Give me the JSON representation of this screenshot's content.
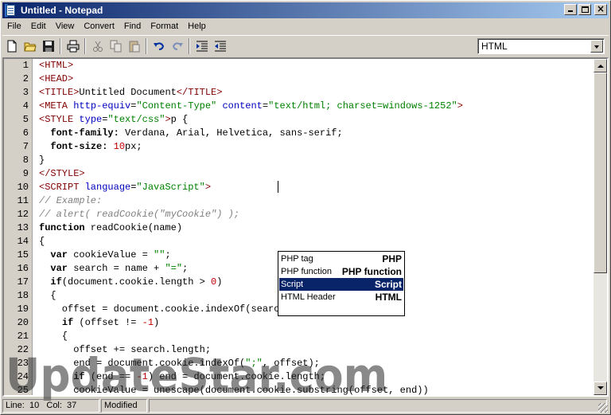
{
  "window": {
    "title": "Untitled - Notepad"
  },
  "menu": [
    "File",
    "Edit",
    "View",
    "Convert",
    "Find",
    "Format",
    "Help"
  ],
  "toolbar": {
    "buttons": [
      "new-file",
      "open-folder",
      "save",
      "print",
      "cut",
      "copy",
      "paste",
      "undo",
      "redo",
      "indent",
      "outdent"
    ],
    "language_selected": "HTML"
  },
  "gutter": {
    "line_numbers": [
      "1",
      "2",
      "3",
      "4",
      "5",
      "6",
      "7",
      "8",
      "9",
      "10",
      "11",
      "12",
      "13",
      "14",
      "15",
      "16",
      "17",
      "18",
      "19",
      "20",
      "21",
      "22",
      "23",
      "24",
      "25"
    ]
  },
  "code_lines": [
    [
      [
        "t-tag",
        "<HTML>"
      ]
    ],
    [
      [
        "t-tag",
        "<HEAD>"
      ]
    ],
    [
      [
        "t-tag",
        "<TITLE>"
      ],
      [
        "t-txt",
        "Untitled Document"
      ],
      [
        "t-tag",
        "</TITLE>"
      ]
    ],
    [
      [
        "t-tag",
        "<META "
      ],
      [
        "t-attr",
        "http-equiv"
      ],
      [
        "t-txt",
        "="
      ],
      [
        "t-str",
        "\"Content-Type\""
      ],
      [
        "t-txt",
        " "
      ],
      [
        "t-attr",
        "content"
      ],
      [
        "t-txt",
        "="
      ],
      [
        "t-str",
        "\"text/html; charset=windows-1252\""
      ],
      [
        "t-tag",
        ">"
      ]
    ],
    [
      [
        "t-tag",
        "<STYLE "
      ],
      [
        "t-attr",
        "type"
      ],
      [
        "t-txt",
        "="
      ],
      [
        "t-str",
        "\"text/css\""
      ],
      [
        "t-tag",
        ">"
      ],
      [
        "t-txt",
        "p {"
      ]
    ],
    [
      [
        "t-txt",
        "  "
      ],
      [
        "t-kw",
        "font-family:"
      ],
      [
        "t-txt",
        " Verdana, Arial, Helvetica, sans-serif;"
      ]
    ],
    [
      [
        "t-txt",
        "  "
      ],
      [
        "t-kw",
        "font-size:"
      ],
      [
        "t-txt",
        " "
      ],
      [
        "t-num",
        "10"
      ],
      [
        "t-txt",
        "px;"
      ]
    ],
    [
      [
        "t-txt",
        "}"
      ]
    ],
    [
      [
        "t-tag",
        "</STYLE>"
      ]
    ],
    [
      [
        "t-tag",
        "<SCRIPT "
      ],
      [
        "t-attr",
        "language"
      ],
      [
        "t-txt",
        "="
      ],
      [
        "t-str",
        "\"JavaScript\""
      ],
      [
        "t-tag",
        ">"
      ]
    ],
    [
      [
        "t-cmt",
        "// Example:"
      ]
    ],
    [
      [
        "t-cmt",
        "// alert( readCookie(\"myCookie\") );"
      ]
    ],
    [
      [
        "t-kw",
        "function"
      ],
      [
        "t-txt",
        " readCookie(name)"
      ]
    ],
    [
      [
        "t-txt",
        "{"
      ]
    ],
    [
      [
        "t-txt",
        "  "
      ],
      [
        "t-kw",
        "var"
      ],
      [
        "t-txt",
        " cookieValue = "
      ],
      [
        "t-str",
        "\"\""
      ],
      [
        "t-txt",
        ";"
      ]
    ],
    [
      [
        "t-txt",
        "  "
      ],
      [
        "t-kw",
        "var"
      ],
      [
        "t-txt",
        " search = name + "
      ],
      [
        "t-str",
        "\"=\""
      ],
      [
        "t-txt",
        ";"
      ]
    ],
    [
      [
        "t-txt",
        "  "
      ],
      [
        "t-kw",
        "if"
      ],
      [
        "t-txt",
        "(document.cookie.length > "
      ],
      [
        "t-num",
        "0"
      ],
      [
        "t-txt",
        ")"
      ]
    ],
    [
      [
        "t-txt",
        "  {"
      ]
    ],
    [
      [
        "t-txt",
        "    offset = document.cookie.indexOf(search);"
      ]
    ],
    [
      [
        "t-txt",
        "    "
      ],
      [
        "t-kw",
        "if"
      ],
      [
        "t-txt",
        " (offset != "
      ],
      [
        "t-num",
        "-1"
      ],
      [
        "t-txt",
        ")"
      ]
    ],
    [
      [
        "t-txt",
        "    {"
      ]
    ],
    [
      [
        "t-txt",
        "      offset += search.length;"
      ]
    ],
    [
      [
        "t-txt",
        "      end = document.cookie.indexOf("
      ],
      [
        "t-str",
        "\";\""
      ],
      [
        "t-txt",
        ", offset);"
      ]
    ],
    [
      [
        "t-txt",
        "      "
      ],
      [
        "t-kw",
        "if"
      ],
      [
        "t-txt",
        " (end == "
      ],
      [
        "t-num",
        "-1"
      ],
      [
        "t-txt",
        ") end = document.cookie.length;"
      ]
    ],
    [
      [
        "t-txt",
        "      cookieValue = unescape(document.cookie.substring(offset, end))"
      ]
    ]
  ],
  "autocomplete": {
    "items": [
      {
        "left": "PHP tag",
        "right": "PHP"
      },
      {
        "left": "PHP function",
        "right": "PHP function"
      },
      {
        "left": "Script",
        "right": "Script",
        "selected": true
      },
      {
        "left": "HTML Header",
        "right": "HTML"
      }
    ]
  },
  "status": {
    "position": "Line:  10   Col:  37",
    "modified": "Modified"
  },
  "watermark": "UpdateStar.com"
}
